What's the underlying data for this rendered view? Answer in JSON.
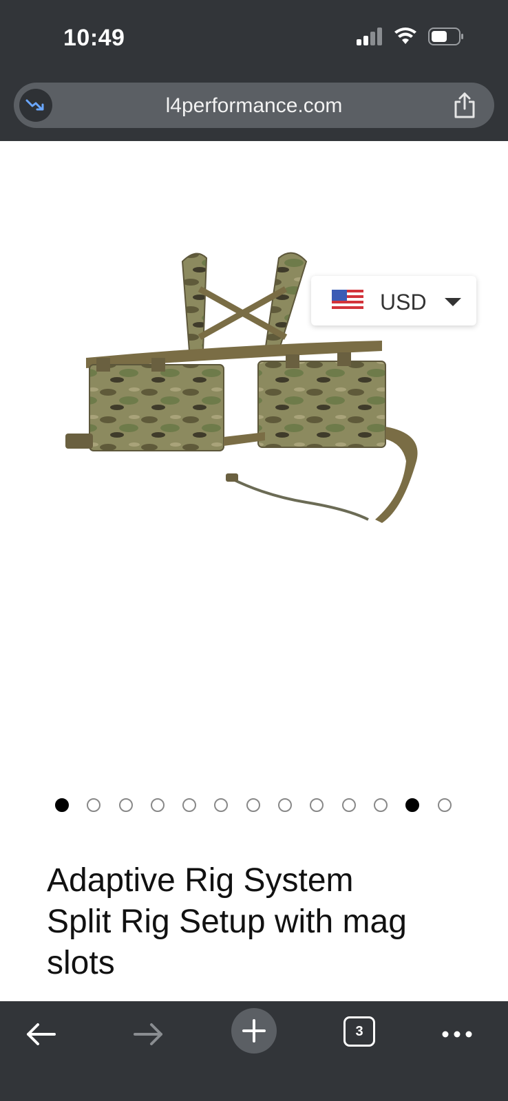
{
  "status": {
    "time": "10:49"
  },
  "browser": {
    "url": "l4performance.com",
    "tab_count": "3"
  },
  "currency": {
    "label": "USD"
  },
  "carousel": {
    "total": 13,
    "active_indices": [
      0,
      11
    ]
  },
  "product": {
    "title_line1": "Adaptive Rig System",
    "title_line2": "Split Rig Setup with mag",
    "title_line3": "slots"
  },
  "icons": {
    "signal": "signal-icon",
    "wifi": "wifi-icon",
    "battery": "battery-icon",
    "trend": "trend-down-icon",
    "share": "share-icon",
    "back": "arrow-left-icon",
    "forward": "arrow-right-icon",
    "new_tab": "plus-icon",
    "menu": "more-dots-icon"
  }
}
